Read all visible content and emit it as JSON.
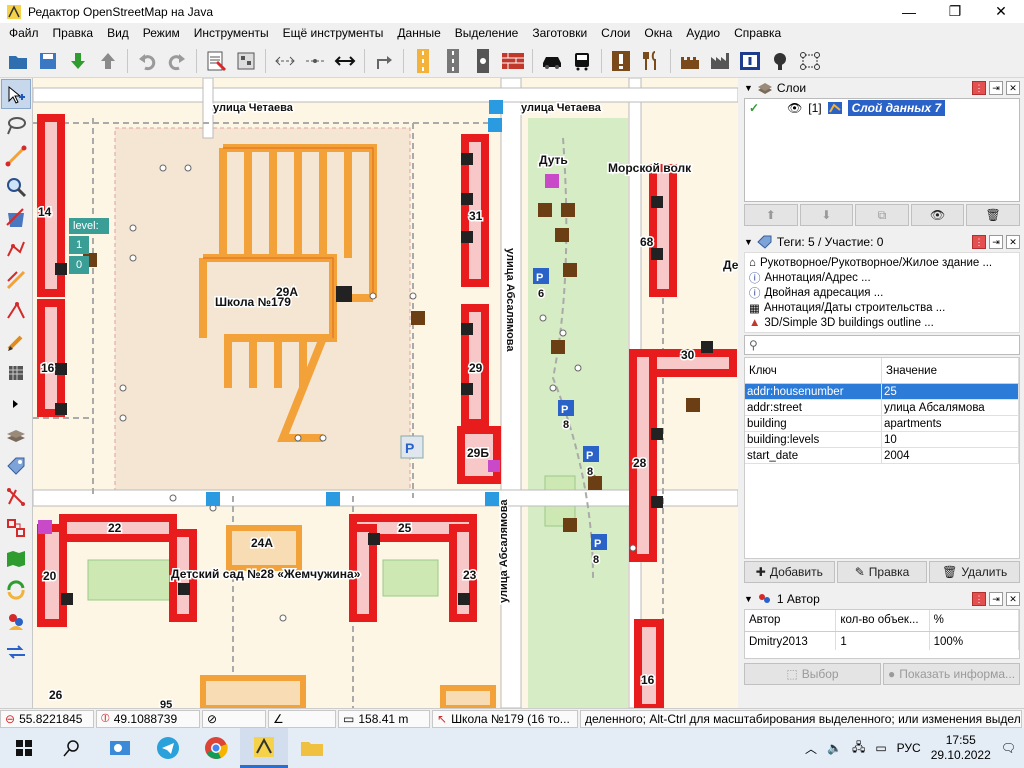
{
  "window": {
    "title": "Редактор OpenStreetMap на Java"
  },
  "menu": [
    "Файл",
    "Правка",
    "Вид",
    "Режим",
    "Инструменты",
    "Ещё инструменты",
    "Данные",
    "Выделение",
    "Заготовки",
    "Слои",
    "Окна",
    "Аудио",
    "Справка"
  ],
  "map": {
    "level_label": "level:",
    "levels": [
      "1",
      "0"
    ],
    "labels": {
      "street_chetaeva": "улица Четаева",
      "street_chetaeva_2": "улица Четаева",
      "street_absalyamova": "улица Абсалямова",
      "street_absalyamova_2": "улица Абсалямова",
      "school": "Школа №179",
      "kindergarten": "Детский сад №28 «Жемчужина»",
      "morskoy_volk": "Морской волк",
      "dut": "Дуть",
      "de": "Де",
      "h14": "14",
      "h16": "16",
      "h20": "20",
      "h22": "22",
      "h24a": "24А",
      "h25": "25",
      "h23": "23",
      "h26": "26",
      "h29a": "29А",
      "h29": "29",
      "h29b": "29Б",
      "h31": "31",
      "h68": "68",
      "h30": "30",
      "h28": "28",
      "h16b": "16",
      "h6": "6",
      "h8a": "8",
      "h8b": "8",
      "h8c": "8",
      "h95": "95"
    }
  },
  "layers_panel": {
    "title": "Слои",
    "layer": {
      "index": "[1]",
      "name": "Слой данных 7"
    }
  },
  "tags_panel": {
    "title": "Теги: 5 / Участие: 0",
    "presets": [
      "Рукотворное/Рукотворное/Жилое здание ...",
      "Аннотация/Адрес ...",
      "Двойная адресация ...",
      "Аннотация/Даты строительства ...",
      "3D/Simple 3D buildings outline ..."
    ],
    "col_key": "Ключ",
    "col_value": "Значение",
    "rows": [
      {
        "key": "addr:housenumber",
        "value": "25"
      },
      {
        "key": "addr:street",
        "value": "улица Абсалямова"
      },
      {
        "key": "building",
        "value": "apartments"
      },
      {
        "key": "building:levels",
        "value": "10"
      },
      {
        "key": "start_date",
        "value": "2004"
      }
    ],
    "btn_add": "Добавить",
    "btn_edit": "Правка",
    "btn_delete": "Удалить"
  },
  "authors_panel": {
    "title": "1 Автор",
    "col_author": "Автор",
    "col_count": "кол-во объек...",
    "col_pct": "%",
    "row": {
      "author": "Dmitry2013",
      "count": "1",
      "pct": "100%"
    },
    "btn_select": "Выбор",
    "btn_info": "Показать информа..."
  },
  "status": {
    "lat": "55.8221845",
    "lon": "49.1088739",
    "dist": "158.41 m",
    "name": "Школа №179 (16 то...",
    "help": "деленного; Alt-Ctrl для масштабирования выделенного; или изменения выделения."
  },
  "taskbar": {
    "lang": "РУС",
    "time": "17:55",
    "date": "29.10.2022"
  },
  "colors": {
    "accent_red": "#e81c1c",
    "accent_orange": "#f3a23a",
    "selection_blue": "#2d7bd8",
    "level_teal": "#3a9e97"
  }
}
